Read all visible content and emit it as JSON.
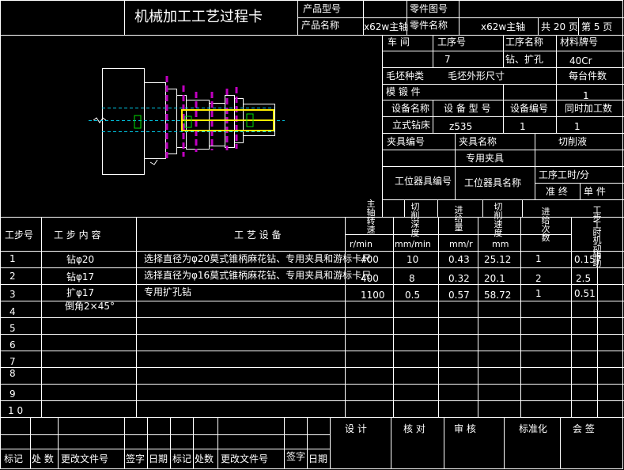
{
  "header": {
    "title": "机械加工工艺过程卡",
    "product_model_label": "产品型号",
    "product_name_label": "产品名称",
    "product_name_value": "x62w主轴",
    "part_no_label": "零件图号",
    "part_name_label": "零件名称",
    "part_name_value": "x62w主轴",
    "total_pages": "共 20 页",
    "page_no": "第 5 页"
  },
  "info": {
    "workshop_label": "车 间",
    "process_no_label": "工序号",
    "process_name_label": "工序名称",
    "material_label": "材料牌号",
    "process_no_value": "7",
    "process_name_value": "钻、扩孔",
    "material_value": "40Cr",
    "blank_type_label": "毛坯种类",
    "blank_size_label": "毛坯外形尺寸",
    "pieces_per_blank_label": "每台件数",
    "forging_label": "模 锻 件",
    "pieces_value": "1",
    "equip_name_label": "设备名称",
    "equip_model_label": "设 备 型 号",
    "equip_no_label": "设备编号",
    "simul_label": "同时加工数",
    "equip_name_value": "立式钻床",
    "equip_model_value": "z535",
    "equip_no_value": "1",
    "simul_value": "1",
    "fixture_no_label": "夹具编号",
    "fixture_name_label": "夹具名称",
    "coolant_label": "切削液",
    "fixture_name_value": "专用夹具",
    "station_tool_no_label": "工位器具编号",
    "station_tool_name_label": "工位器具名称",
    "process_hours_label": "工序工时/分",
    "prep_label": "准 终",
    "unit_label": "单 件"
  },
  "steps": {
    "col_step": "工步号",
    "col_content": "工 步 内 容",
    "col_equipment": "工 艺 设 备",
    "col_spindle": "主 轴 转 速",
    "col_spindle_unit": "r/min",
    "col_depth": "切 削 深 度",
    "col_depth_unit": "mm/min",
    "col_feed": "进 给 量",
    "col_feed_unit": "mm/r",
    "col_speed": "切 削 速 度",
    "col_speed_unit": "mm",
    "col_passes": "进 给 次 数",
    "col_hours": "工 步 工 时 机 动 辅 助",
    "rows": [
      {
        "no": "1",
        "content": "钻φ20",
        "equipment": "选择直径为φ20莫式锥柄麻花钻、专用夹具和游标卡尺",
        "spindle": "400",
        "depth": "10",
        "feed": "0.43",
        "speed": "25.12",
        "passes": "1",
        "hours": "0.157"
      },
      {
        "no": "2",
        "content": "钻φ17",
        "equipment": "选择直径为φ16莫式锥柄麻花钻、专用夹具和游标卡尺",
        "spindle": "400",
        "depth": "8",
        "feed": "0.32",
        "speed": "20.1",
        "passes": "2",
        "hours": "2.5"
      },
      {
        "no": "3",
        "content": "扩φ17",
        "content2": "倒角2×45°",
        "equipment": "专用扩孔钻",
        "spindle": "1100",
        "depth": "0.5",
        "feed": "0.57",
        "speed": "58.72",
        "passes": "1",
        "hours": "0.51"
      },
      {
        "no": "4"
      },
      {
        "no": "5"
      },
      {
        "no": "6"
      },
      {
        "no": "7"
      },
      {
        "no": "8"
      },
      {
        "no": "9"
      },
      {
        "no": "1 0"
      }
    ]
  },
  "footer": {
    "design": "设 计",
    "check": "核 对",
    "review": "审 核",
    "standard": "标准化",
    "sign": "会 签",
    "marks": [
      "标记",
      "处 数",
      "更改文件号",
      "签字",
      "日期",
      "标记",
      "处数",
      "更改文件号",
      "签字",
      "日期"
    ]
  },
  "colors": {
    "line": "#ffffff",
    "cyan": "#00c8e6",
    "magenta": "#c000c0",
    "yellow": "#ffee00",
    "green": "#00e000"
  }
}
